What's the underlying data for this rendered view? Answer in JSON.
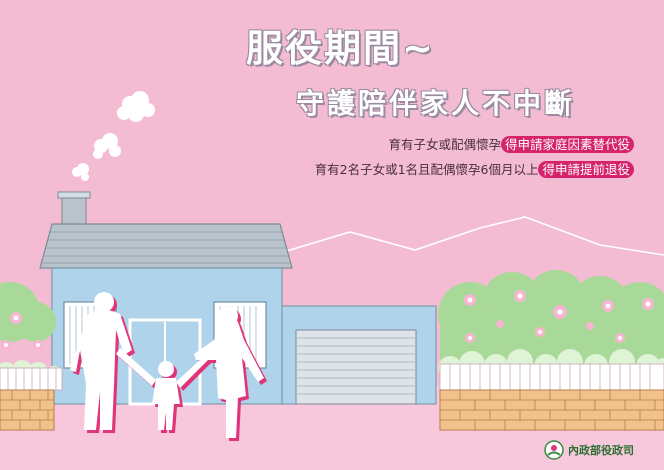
{
  "title": {
    "line1": "服役期間~",
    "line2": "守護陪伴家人不中斷"
  },
  "details": [
    {
      "prefix": "育有子女或配偶懷孕",
      "highlight": "得申請家庭因素替代役"
    },
    {
      "prefix": "育有2名子女或1名且配偶懷孕6個月以上",
      "highlight": "得申請提前退役"
    }
  ],
  "logo": {
    "text": "內政部役政司",
    "icon": "ministry-logo-icon"
  },
  "colors": {
    "background": "#f4bcd3",
    "highlight": "#d6246c",
    "house": "#aed3ea",
    "roof": "#b9c3cb",
    "bush": "#a9d998",
    "brick": "#f2c28c"
  }
}
